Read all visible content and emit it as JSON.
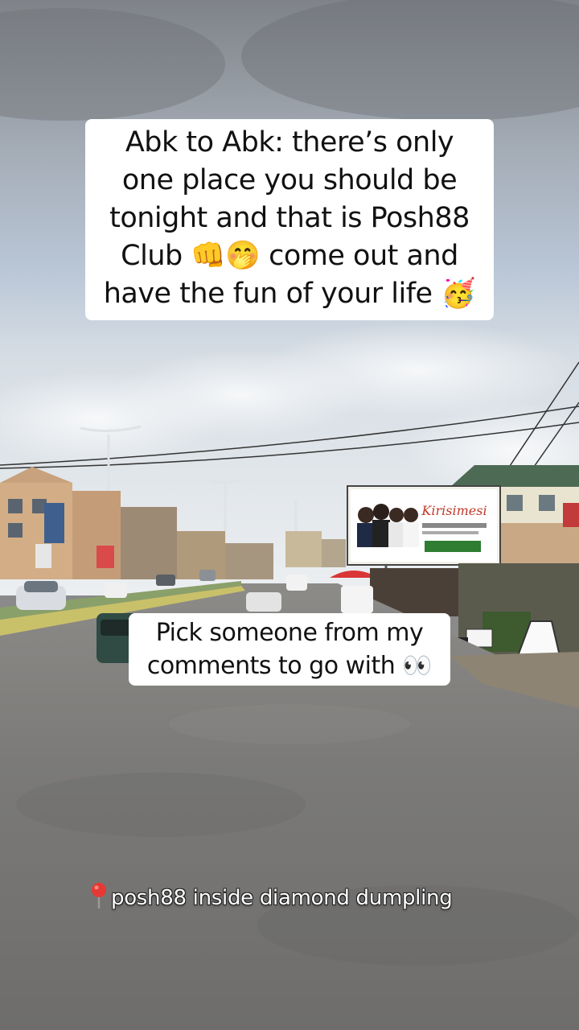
{
  "overlay_top": {
    "lines": [
      "Abk to Abk: there’s only",
      "one place you should be",
      "tonight and that is Posh88",
      "Club 👊🤭 come out and",
      "have the fun of your life 🥳"
    ]
  },
  "overlay_mid": {
    "lines": [
      "Pick someone from my",
      "comments to go with 👀"
    ]
  },
  "location_tag": {
    "icon": "map-pin-icon",
    "text": "posh88 inside diamond dumpling"
  },
  "billboard": {
    "text": "Kirisimesi"
  },
  "colors": {
    "sky_top": "#8f9398",
    "sky_mid": "#b7c3d2",
    "road": "#7d7c7a",
    "caption_bg": "#ffffff",
    "pin": "#e53935"
  }
}
